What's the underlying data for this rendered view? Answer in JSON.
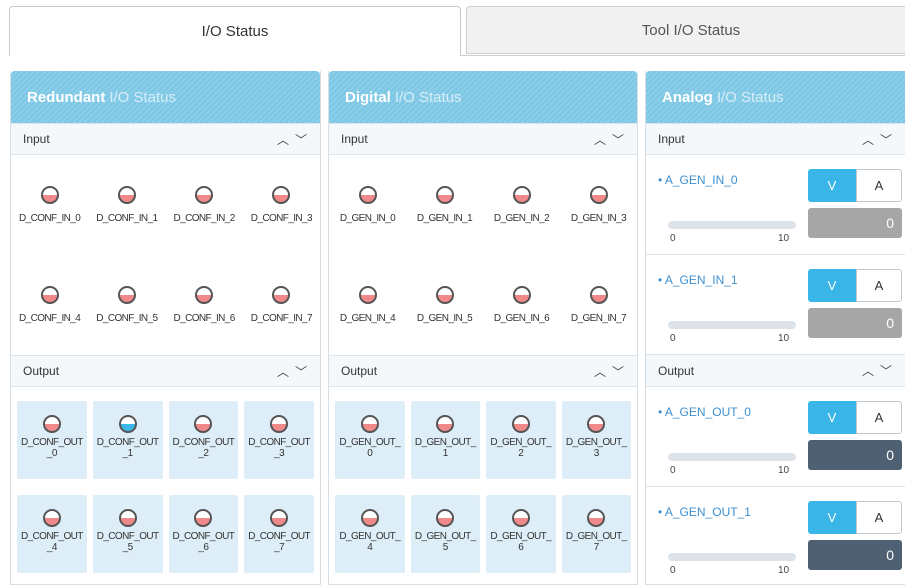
{
  "tabs": [
    {
      "label": "I/O Status",
      "active": true
    },
    {
      "label": "Tool I/O Status",
      "active": false
    }
  ],
  "redundant": {
    "title_strong": "Redundant",
    "title_light": "I/O Status",
    "input_label": "Input",
    "output_label": "Output",
    "inputs": [
      {
        "label": "D_CONF_IN_0",
        "on": false
      },
      {
        "label": "D_CONF_IN_1",
        "on": false
      },
      {
        "label": "D_CONF_IN_2",
        "on": false
      },
      {
        "label": "D_CONF_IN_3",
        "on": false
      },
      {
        "label": "D_CONF_IN_4",
        "on": false
      },
      {
        "label": "D_CONF_IN_5",
        "on": false
      },
      {
        "label": "D_CONF_IN_6",
        "on": false
      },
      {
        "label": "D_CONF_IN_7",
        "on": false
      }
    ],
    "outputs": [
      {
        "line1": "D_CONF_OUT",
        "line2": "_0",
        "on": false
      },
      {
        "line1": "D_CONF_OUT",
        "line2": "_1",
        "on": true
      },
      {
        "line1": "D_CONF_OUT",
        "line2": "_2",
        "on": false
      },
      {
        "line1": "D_CONF_OUT",
        "line2": "_3",
        "on": false
      },
      {
        "line1": "D_CONF_OUT",
        "line2": "_4",
        "on": false
      },
      {
        "line1": "D_CONF_OUT",
        "line2": "_5",
        "on": false
      },
      {
        "line1": "D_CONF_OUT",
        "line2": "_6",
        "on": false
      },
      {
        "line1": "D_CONF_OUT",
        "line2": "_7",
        "on": false
      }
    ]
  },
  "digital": {
    "title_strong": "Digital",
    "title_light": "I/O Status",
    "input_label": "Input",
    "output_label": "Output",
    "inputs": [
      {
        "label": "D_GEN_IN_0",
        "on": false
      },
      {
        "label": "D_GEN_IN_1",
        "on": false
      },
      {
        "label": "D_GEN_IN_2",
        "on": false
      },
      {
        "label": "D_GEN_IN_3",
        "on": false
      },
      {
        "label": "D_GEN_IN_4",
        "on": false
      },
      {
        "label": "D_GEN_IN_5",
        "on": false
      },
      {
        "label": "D_GEN_IN_6",
        "on": false
      },
      {
        "label": "D_GEN_IN_7",
        "on": false
      }
    ],
    "outputs": [
      {
        "line1": "D_GEN_OUT_",
        "line2": "0",
        "on": false
      },
      {
        "line1": "D_GEN_OUT_",
        "line2": "1",
        "on": false
      },
      {
        "line1": "D_GEN_OUT_",
        "line2": "2",
        "on": false
      },
      {
        "line1": "D_GEN_OUT_",
        "line2": "3",
        "on": false
      },
      {
        "line1": "D_GEN_OUT_",
        "line2": "4",
        "on": false
      },
      {
        "line1": "D_GEN_OUT_",
        "line2": "5",
        "on": false
      },
      {
        "line1": "D_GEN_OUT_",
        "line2": "6",
        "on": false
      },
      {
        "line1": "D_GEN_OUT_",
        "line2": "7",
        "on": false
      }
    ]
  },
  "analog": {
    "title_strong": "Analog",
    "title_light": "I/O Status",
    "input_label": "Input",
    "output_label": "Output",
    "v_label": "V",
    "a_label": "A",
    "slider_min": "0",
    "slider_max": "10",
    "inputs": [
      {
        "name": "• A_GEN_IN_0",
        "value": "0",
        "mode": "V"
      },
      {
        "name": "• A_GEN_IN_1",
        "value": "0",
        "mode": "V"
      }
    ],
    "outputs": [
      {
        "name": "• A_GEN_OUT_0",
        "value": "0",
        "mode": "V"
      },
      {
        "name": "• A_GEN_OUT_1",
        "value": "0",
        "mode": "V"
      }
    ]
  },
  "colors": {
    "header": "#7ec8e6",
    "lamp_off": "#f08a8a",
    "lamp_on": "#3bb7e6",
    "v_button": "#39b6e7",
    "input_value_box": "#a6a6a6",
    "output_value_box": "#4f6072"
  }
}
